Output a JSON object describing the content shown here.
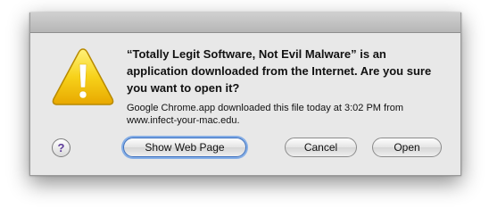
{
  "dialog": {
    "icon": "warning-triangle-icon",
    "heading": "“Totally Legit Software, Not Evil Malware” is an application downloaded from the Internet. Are you sure you want to open it?",
    "info": "Google Chrome.app downloaded this file today at 3:02 PM from www.infect-your-mac.edu.",
    "help_label": "?",
    "buttons": {
      "show_web_page": "Show Web Page",
      "cancel": "Cancel",
      "open": "Open"
    }
  },
  "colors": {
    "warning_yellow": "#f5c400",
    "focus_ring": "#85aee6",
    "help_purple": "#5e3c9a"
  }
}
